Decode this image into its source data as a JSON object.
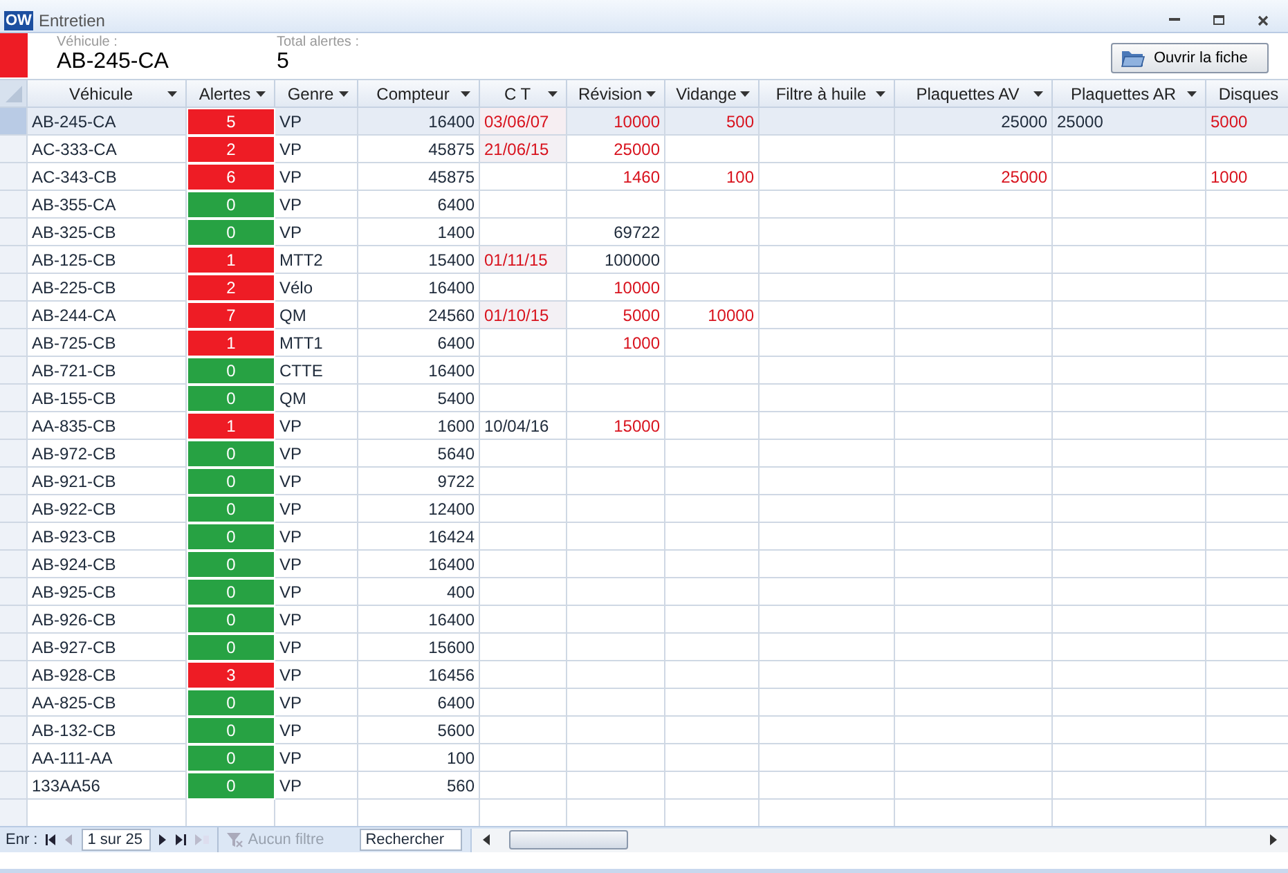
{
  "window": {
    "title": "Entretien",
    "app_badge": "OW"
  },
  "header": {
    "vehicle_label": "Véhicule :",
    "vehicle_value": "AB-245-CA",
    "alerts_label": "Total alertes :",
    "alerts_value": "5",
    "record_alert": true,
    "open_button": "Ouvrir la fiche"
  },
  "table": {
    "columns": [
      "Véhicule",
      "Alertes",
      "Genre",
      "Compteur",
      "C T",
      "Révision",
      "Vidange",
      "Filtre à huile",
      "Plaquettes AV",
      "Plaquettes AR",
      "Disques"
    ],
    "rows": [
      {
        "selected": true,
        "vehicule": "AB-245-CA",
        "alertes": {
          "text": "5",
          "alert": true
        },
        "genre": "VP",
        "compteur": "16400",
        "ct": {
          "text": "03/06/07",
          "alert": true,
          "highlighted": true
        },
        "revision": {
          "text": "10000",
          "alert": true
        },
        "vidange": {
          "text": "500",
          "alert": true
        },
        "plaquettes_av": {
          "text": "25000",
          "alert": false
        },
        "plaquettes_ar": {
          "text": "25000",
          "alert": false
        },
        "disques": {
          "text": "5000",
          "alert": true
        }
      },
      {
        "selected": false,
        "vehicule": "AC-333-CA",
        "alertes": {
          "text": "2",
          "alert": true
        },
        "genre": "VP",
        "compteur": "45875",
        "ct": {
          "text": "21/06/15",
          "alert": true,
          "highlighted": true
        },
        "revision": {
          "text": "25000",
          "alert": true
        }
      },
      {
        "selected": false,
        "vehicule": "AC-343-CB",
        "alertes": {
          "text": "6",
          "alert": true
        },
        "genre": "VP",
        "compteur": "45875",
        "revision": {
          "text": "1460",
          "alert": true
        },
        "vidange": {
          "text": "100",
          "alert": true
        },
        "plaquettes_av": {
          "text": "25000",
          "alert": true
        },
        "disques": {
          "text": "1000",
          "alert": true
        }
      },
      {
        "selected": false,
        "vehicule": "AB-355-CA",
        "alertes": {
          "text": "0",
          "alert": false
        },
        "genre": "VP",
        "compteur": "6400"
      },
      {
        "selected": false,
        "vehicule": "AB-325-CB",
        "alertes": {
          "text": "0",
          "alert": false
        },
        "genre": "VP",
        "compteur": "1400",
        "revision": {
          "text": "69722",
          "alert": false
        }
      },
      {
        "selected": false,
        "vehicule": "AB-125-CB",
        "alertes": {
          "text": "1",
          "alert": true
        },
        "genre": "MTT2",
        "compteur": "15400",
        "ct": {
          "text": "01/11/15",
          "alert": true,
          "highlighted": true
        },
        "revision": {
          "text": "100000",
          "alert": false
        }
      },
      {
        "selected": false,
        "vehicule": "AB-225-CB",
        "alertes": {
          "text": "2",
          "alert": true
        },
        "genre": "Vélo",
        "compteur": "16400",
        "revision": {
          "text": "10000",
          "alert": true
        }
      },
      {
        "selected": false,
        "vehicule": "AB-244-CA",
        "alertes": {
          "text": "7",
          "alert": true
        },
        "genre": "QM",
        "compteur": "24560",
        "ct": {
          "text": "01/10/15",
          "alert": true,
          "highlighted": true
        },
        "revision": {
          "text": "5000",
          "alert": true
        },
        "vidange": {
          "text": "10000",
          "alert": true
        }
      },
      {
        "selected": false,
        "vehicule": "AB-725-CB",
        "alertes": {
          "text": "1",
          "alert": true
        },
        "genre": "MTT1",
        "compteur": "6400",
        "revision": {
          "text": "1000",
          "alert": true
        }
      },
      {
        "selected": false,
        "vehicule": "AB-721-CB",
        "alertes": {
          "text": "0",
          "alert": false
        },
        "genre": "CTTE",
        "compteur": "16400"
      },
      {
        "selected": false,
        "vehicule": "AB-155-CB",
        "alertes": {
          "text": "0",
          "alert": false
        },
        "genre": "QM",
        "compteur": "5400"
      },
      {
        "selected": false,
        "vehicule": "AA-835-CB",
        "alertes": {
          "text": "1",
          "alert": true
        },
        "genre": "VP",
        "compteur": "1600",
        "ct": {
          "text": "10/04/16",
          "alert": false,
          "highlighted": false
        },
        "revision": {
          "text": "15000",
          "alert": true
        }
      },
      {
        "selected": false,
        "vehicule": "AB-972-CB",
        "alertes": {
          "text": "0",
          "alert": false
        },
        "genre": "VP",
        "compteur": "5640"
      },
      {
        "selected": false,
        "vehicule": "AB-921-CB",
        "alertes": {
          "text": "0",
          "alert": false
        },
        "genre": "VP",
        "compteur": "9722"
      },
      {
        "selected": false,
        "vehicule": "AB-922-CB",
        "alertes": {
          "text": "0",
          "alert": false
        },
        "genre": "VP",
        "compteur": "12400"
      },
      {
        "selected": false,
        "vehicule": "AB-923-CB",
        "alertes": {
          "text": "0",
          "alert": false
        },
        "genre": "VP",
        "compteur": "16424"
      },
      {
        "selected": false,
        "vehicule": "AB-924-CB",
        "alertes": {
          "text": "0",
          "alert": false
        },
        "genre": "VP",
        "compteur": "16400"
      },
      {
        "selected": false,
        "vehicule": "AB-925-CB",
        "alertes": {
          "text": "0",
          "alert": false
        },
        "genre": "VP",
        "compteur": "400"
      },
      {
        "selected": false,
        "vehicule": "AB-926-CB",
        "alertes": {
          "text": "0",
          "alert": false
        },
        "genre": "VP",
        "compteur": "16400"
      },
      {
        "selected": false,
        "vehicule": "AB-927-CB",
        "alertes": {
          "text": "0",
          "alert": false
        },
        "genre": "VP",
        "compteur": "15600"
      },
      {
        "selected": false,
        "vehicule": "AB-928-CB",
        "alertes": {
          "text": "3",
          "alert": true
        },
        "genre": "VP",
        "compteur": "16456"
      },
      {
        "selected": false,
        "vehicule": "AA-825-CB",
        "alertes": {
          "text": "0",
          "alert": false
        },
        "genre": "VP",
        "compteur": "6400"
      },
      {
        "selected": false,
        "vehicule": "AB-132-CB",
        "alertes": {
          "text": "0",
          "alert": false
        },
        "genre": "VP",
        "compteur": "5600"
      },
      {
        "selected": false,
        "vehicule": "AA-111-AA",
        "alertes": {
          "text": "0",
          "alert": false
        },
        "genre": "VP",
        "compteur": "100"
      },
      {
        "selected": false,
        "vehicule": "133AA56",
        "alertes": {
          "text": "0",
          "alert": false
        },
        "genre": "VP",
        "compteur": "560"
      }
    ]
  },
  "navigation": {
    "label": "Enr :",
    "position": "1 sur 25",
    "filter": "Aucun filtre",
    "search": "Rechercher"
  }
}
